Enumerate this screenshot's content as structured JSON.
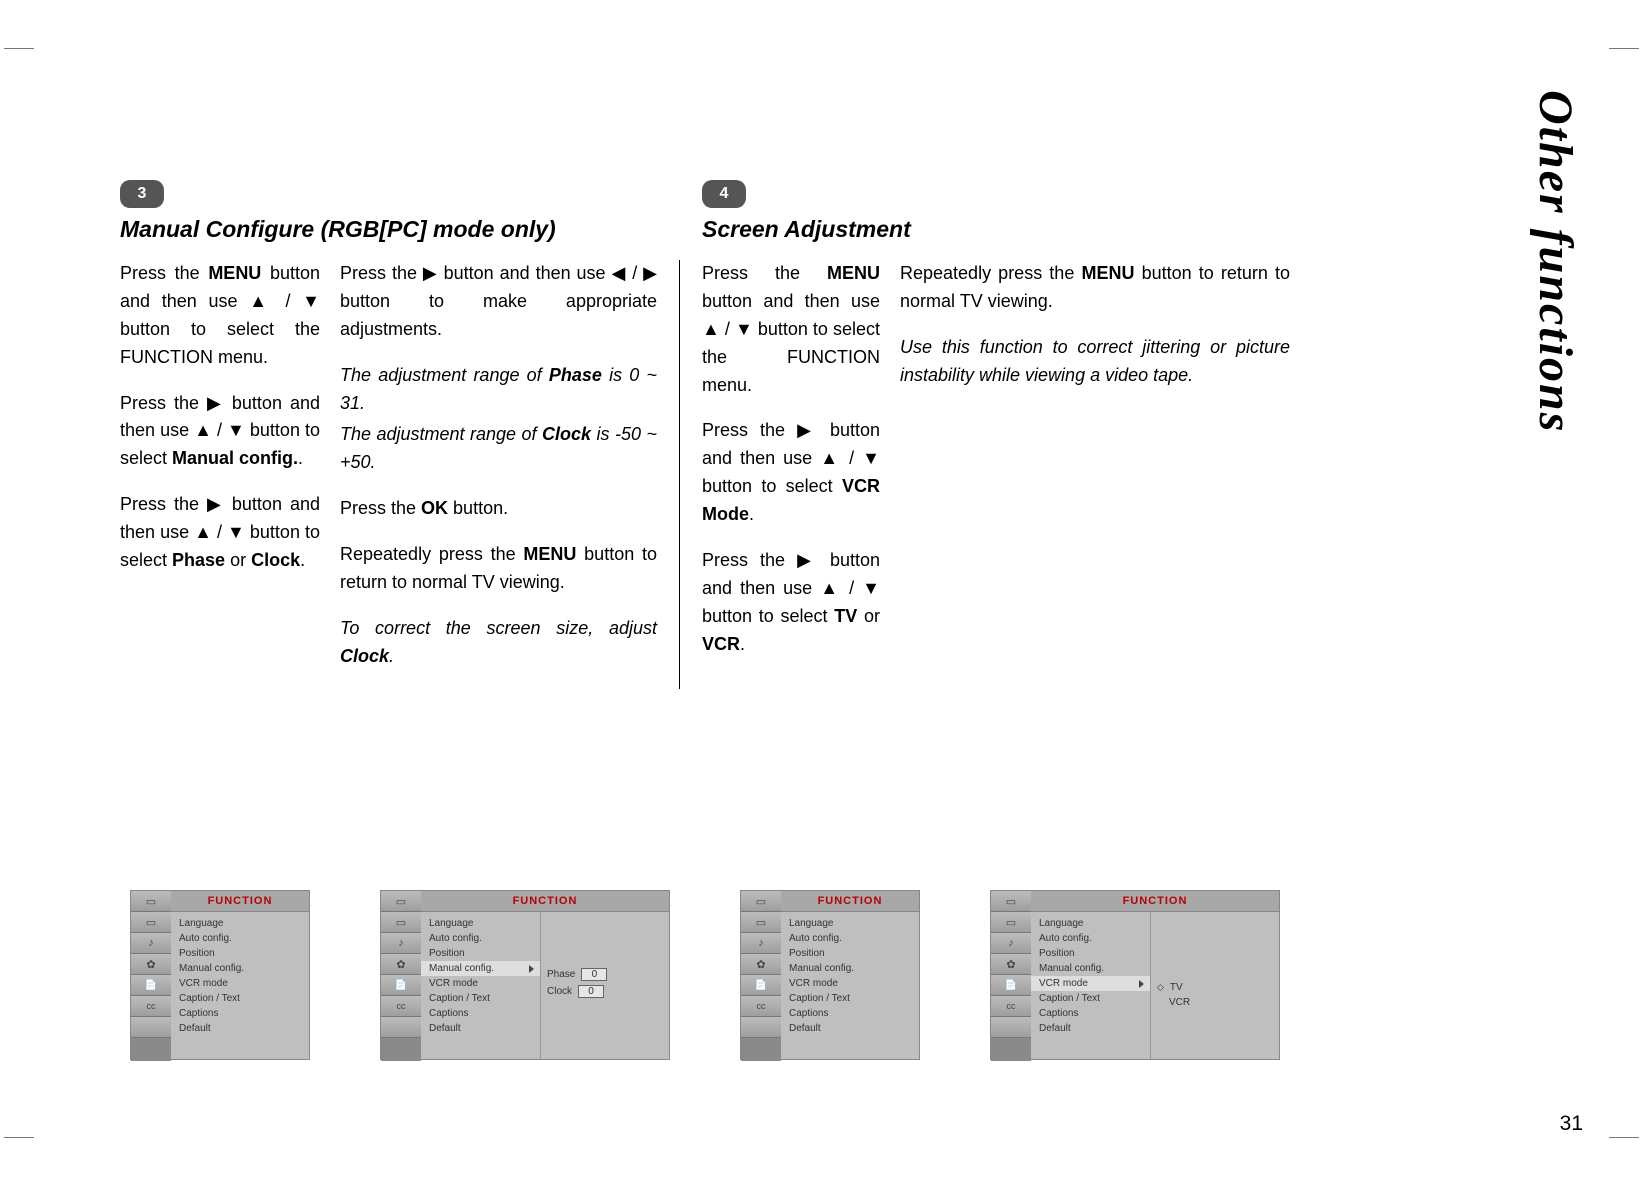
{
  "page_number": "31",
  "side_title": "Other functions",
  "section3": {
    "badge": "3",
    "title": "Manual Configure (RGB[PC] mode only)",
    "col1": {
      "p1a": "Press the ",
      "p1b": "MENU",
      "p1c": " button and then use ▲ / ▼ button to select the FUNCTION menu.",
      "p2a": "Press the ▶ button and then use ▲ / ▼ button to select ",
      "p2b": "Manual config.",
      "p2c": ".",
      "p3a": "Press the ▶ button and then use ▲ / ▼ button to select ",
      "p3b": "Phase",
      "p3c": " or ",
      "p3d": "Clock",
      "p3e": "."
    },
    "col2": {
      "p1": "Press the ▶ button and then use ◀ / ▶ button to make appropriate adjustments.",
      "p2a": "The adjustment range of ",
      "p2b": "Phase",
      "p2c": " is 0 ~ 31.",
      "p3a": "The adjustment range of ",
      "p3b": "Clock",
      "p3c": " is -50 ~ +50.",
      "p4a": "Press the ",
      "p4b": "OK",
      "p4c": " button.",
      "p5a": "Repeatedly press the ",
      "p5b": "MENU",
      "p5c": " button to return to normal TV viewing.",
      "p6a": "To correct the screen size, adjust ",
      "p6b": "Clock",
      "p6c": "."
    }
  },
  "section4": {
    "badge": "4",
    "title": "Screen Adjustment",
    "col1": {
      "p1a": "Press the ",
      "p1b": "MENU",
      "p1c": " button and then use ▲ / ▼ button to select the FUNCTION menu.",
      "p2a": "Press the ▶ button and then use ▲ / ▼ button to select ",
      "p2b": "VCR Mode",
      "p2c": ".",
      "p3a": "Press the ▶ button and then use ▲ / ▼ button to select ",
      "p3b": "TV",
      "p3c": " or ",
      "p3d": "VCR",
      "p3e": "."
    },
    "col2": {
      "p1a": "Repeatedly press the ",
      "p1b": "MENU",
      "p1c": " button to return to normal TV viewing.",
      "p2": "Use this function to correct jittering or picture instability while viewing a video tape."
    }
  },
  "osd": {
    "header": "FUNCTION",
    "items": [
      "Language",
      "Auto config.",
      "Position",
      "Manual config.",
      "VCR mode",
      "Caption / Text",
      "Captions",
      "Default"
    ],
    "phase_label": "Phase",
    "phase_val": "0",
    "clock_label": "Clock",
    "clock_val": "0",
    "vcr_opts": {
      "tv": "TV",
      "vcr": "VCR"
    }
  }
}
